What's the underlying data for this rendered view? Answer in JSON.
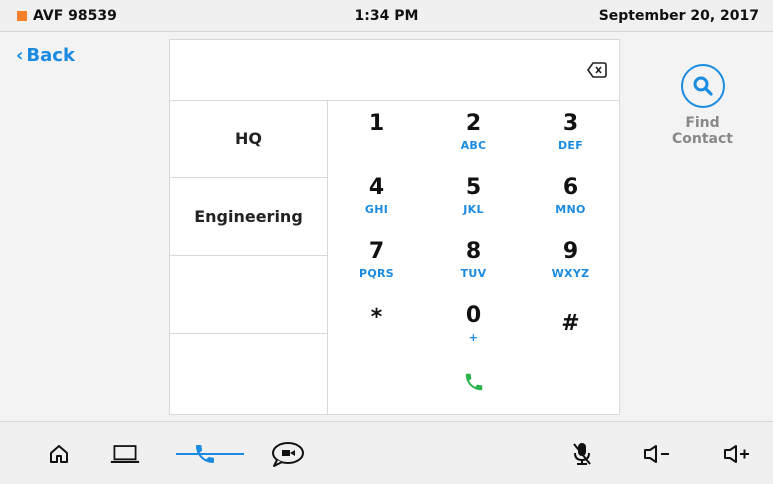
{
  "status": {
    "device": "AVF 98539",
    "time": "1:34 PM",
    "date": "September 20, 2017",
    "device_color": "#f5822a"
  },
  "nav": {
    "back_label": "Back"
  },
  "dialer": {
    "input_value": "",
    "favorites": [
      "HQ",
      "Engineering",
      "",
      ""
    ],
    "keys": [
      {
        "digit": "1",
        "letters": ""
      },
      {
        "digit": "2",
        "letters": "ABC"
      },
      {
        "digit": "3",
        "letters": "DEF"
      },
      {
        "digit": "4",
        "letters": "GHI"
      },
      {
        "digit": "5",
        "letters": "JKL"
      },
      {
        "digit": "6",
        "letters": "MNO"
      },
      {
        "digit": "7",
        "letters": "PQRS"
      },
      {
        "digit": "8",
        "letters": "TUV"
      },
      {
        "digit": "9",
        "letters": "WXYZ"
      },
      {
        "digit": "*",
        "letters": ""
      },
      {
        "digit": "0",
        "letters": "+"
      },
      {
        "digit": "#",
        "letters": ""
      }
    ],
    "call_icon": "phone-call-icon"
  },
  "find_contact": {
    "label": "Find Contact",
    "icon": "search-icon"
  },
  "bottombar": {
    "items": [
      "home-icon",
      "laptop-icon",
      "phone-icon",
      "video-chat-icon",
      "mic-muted-icon",
      "volume-down-icon",
      "volume-up-icon"
    ],
    "active": "phone-icon"
  },
  "colors": {
    "accent": "#1a8be0",
    "call_green": "#2bb24c"
  }
}
